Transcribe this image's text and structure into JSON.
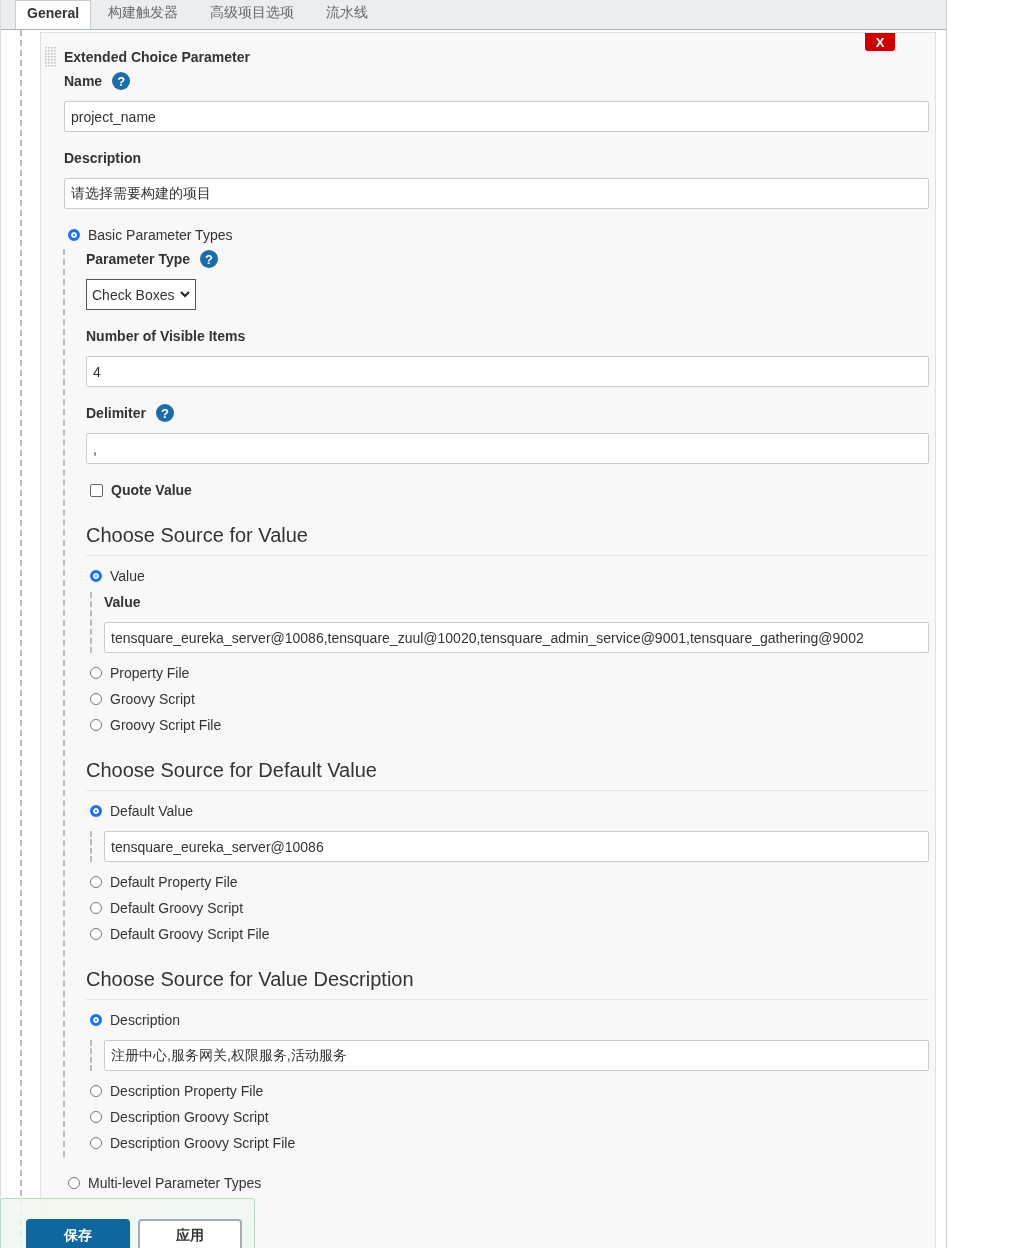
{
  "tabs": [
    {
      "label": "General",
      "selected": true
    },
    {
      "label": "构建触发器",
      "selected": false
    },
    {
      "label": "高级项目选项",
      "selected": false
    },
    {
      "label": "流水线",
      "selected": false
    }
  ],
  "parameter": {
    "title": "Extended Choice Parameter",
    "delete_button": "X",
    "name": {
      "label": "Name",
      "help": "?",
      "value": "project_name"
    },
    "description": {
      "label": "Description",
      "value": "请选择需要构建的项目"
    },
    "types": [
      {
        "label": "Basic Parameter Types",
        "selected": true
      },
      {
        "label": "Multi-level Parameter Types",
        "selected": false
      }
    ]
  },
  "basic": {
    "parameter_type": {
      "label": "Parameter Type",
      "help": "?",
      "value": "Check Boxes"
    },
    "visible_items": {
      "label": "Number of Visible Items",
      "value": "4"
    },
    "delimiter": {
      "label": "Delimiter",
      "help": "?",
      "value": ","
    },
    "quote_value": {
      "label": "Quote Value",
      "checked": false
    }
  },
  "sources": [
    {
      "heading": "Choose Source for Value",
      "options": [
        {
          "label": "Value",
          "selected": true,
          "field_label": "Value",
          "field_value": "tensquare_eureka_server@10086,tensquare_zuul@10020,tensquare_admin_service@9001,tensquare_gathering@9002"
        },
        {
          "label": "Property File",
          "selected": false
        },
        {
          "label": "Groovy Script",
          "selected": false
        },
        {
          "label": "Groovy Script File",
          "selected": false
        }
      ]
    },
    {
      "heading": "Choose Source for Default Value",
      "options": [
        {
          "label": "Default Value",
          "selected": true,
          "field_value": "tensquare_eureka_server@10086"
        },
        {
          "label": "Default Property File",
          "selected": false
        },
        {
          "label": "Default Groovy Script",
          "selected": false
        },
        {
          "label": "Default Groovy Script File",
          "selected": false
        }
      ]
    },
    {
      "heading": "Choose Source for Value Description",
      "options": [
        {
          "label": "Description",
          "selected": true,
          "field_value": "注册中心,服务网关,权限服务,活动服务"
        },
        {
          "label": "Description Property File",
          "selected": false
        },
        {
          "label": "Description Groovy Script",
          "selected": false
        },
        {
          "label": "Description Groovy Script File",
          "selected": false
        }
      ]
    }
  ],
  "buttons": [
    {
      "label": "保存",
      "kind": "primary"
    },
    {
      "label": "应用",
      "kind": "secondary"
    }
  ]
}
